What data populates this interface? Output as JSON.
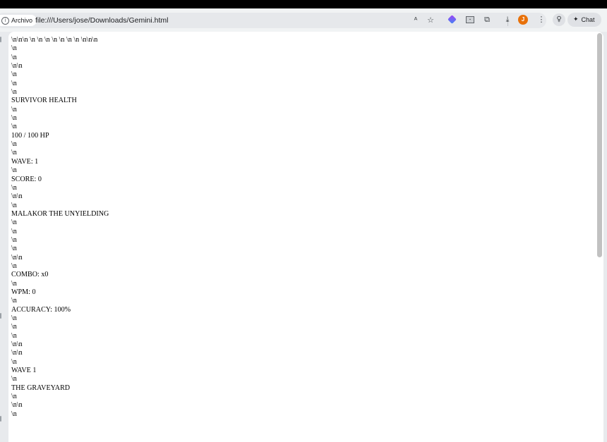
{
  "browser": {
    "site_chip_label": "Archivo",
    "url": "file:///Users/jose/Downloads/Gemini.html",
    "avatar_letter": "J",
    "chat_label": "Chat"
  },
  "page": {
    "lines": [
      "\\n\\n\\n \\n \\n \\n \\n \\n \\n \\n \\n\\n\\n",
      "\\n",
      "\\n",
      "\\n\\n",
      "\\n",
      "\\n",
      "\\n",
      "SURVIVOR HEALTH",
      "\\n",
      "\\n",
      "\\n",
      "100 / 100 HP",
      "\\n",
      "\\n",
      "WAVE: 1",
      "\\n",
      "SCORE: 0",
      "\\n",
      "\\n\\n",
      "\\n",
      "MALAKOR THE UNYIELDING",
      "\\n",
      "\\n",
      "\\n",
      "\\n",
      "\\n\\n",
      "\\n",
      "COMBO: x0",
      "\\n",
      "WPM: 0",
      "\\n",
      "ACCURACY: 100%",
      "\\n",
      "\\n",
      "\\n",
      "\\n\\n",
      "\\n\\n",
      "\\n",
      "WAVE 1",
      "\\n",
      "THE GRAVEYARD",
      "\\n",
      "\\n\\n",
      "\\n"
    ]
  }
}
